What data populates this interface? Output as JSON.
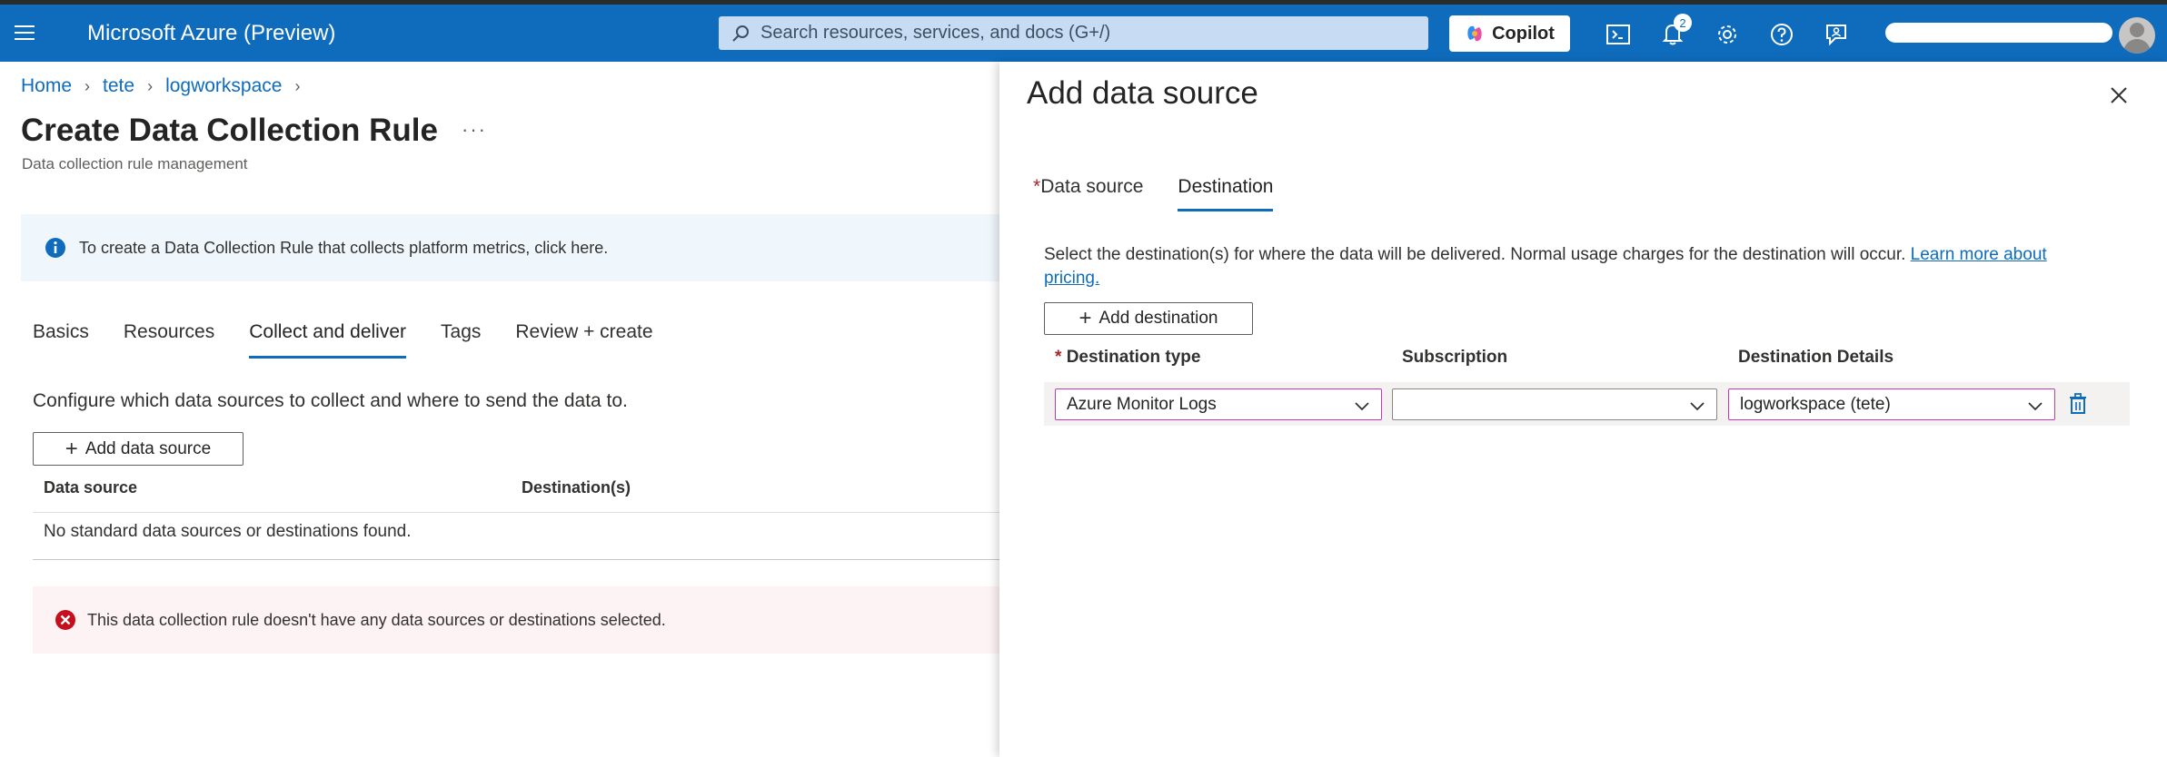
{
  "topbar": {
    "title": "Microsoft Azure (Preview)",
    "search_placeholder": "Search resources, services, and docs (G+/)",
    "copilot_label": "Copilot",
    "notification_count": "2",
    "icons": [
      "hamburger-icon",
      "search-icon",
      "copilot-icon",
      "cloud-shell-icon",
      "bell-icon",
      "gear-icon",
      "help-icon",
      "feedback-icon",
      "avatar-icon"
    ],
    "brand_color": "#0f6cbd"
  },
  "breadcrumb": {
    "items": [
      "Home",
      "tete",
      "logworkspace"
    ]
  },
  "page": {
    "title": "Create Data Collection Rule",
    "more": "···",
    "subtitle": "Data collection rule management",
    "info": "To create a Data Collection Rule that collects platform metrics, click here.",
    "tabs": [
      "Basics",
      "Resources",
      "Collect and deliver",
      "Tags",
      "Review + create"
    ],
    "active_tab": "Collect and deliver",
    "configure_text": "Configure which data sources to collect and where to send the data to.",
    "add_data_source_label": "Add data source",
    "table_headers": [
      "Data source",
      "Destination(s)"
    ],
    "empty_text": "No standard data sources or destinations found.",
    "error_text": "This data collection rule doesn't have any data sources or destinations selected."
  },
  "panel": {
    "title": "Add data source",
    "tabs": [
      {
        "label": "Data source",
        "required": true
      },
      {
        "label": "Destination",
        "required": false
      }
    ],
    "required_mark": "*",
    "description": "Select the destination(s) for where the data will be delivered. Normal usage charges for the destination will occur.",
    "learn_more": "Learn more about pricing.",
    "add_destination_label": "Add destination",
    "columns": [
      "Destination type",
      "Subscription",
      "Destination Details"
    ],
    "row": {
      "destination_type": "Azure Monitor Logs",
      "subscription": "",
      "destination_details": "logworkspace (tete)"
    }
  }
}
